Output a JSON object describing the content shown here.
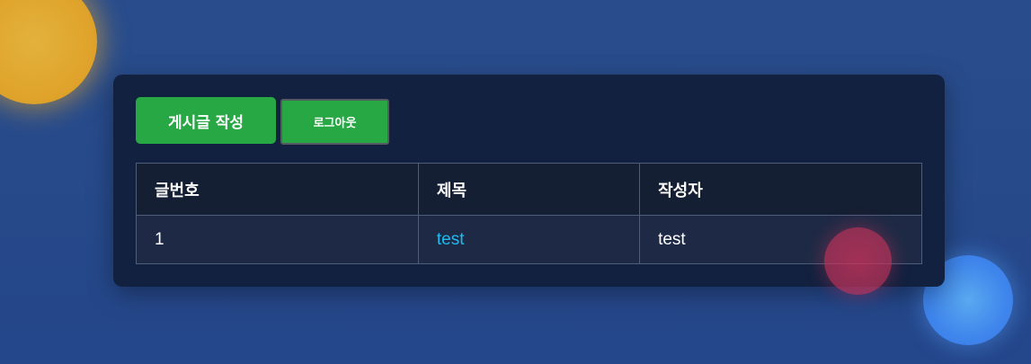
{
  "toolbar": {
    "write_label": "게시글 작성",
    "logout_label": "로그아웃"
  },
  "table": {
    "headers": {
      "number": "글번호",
      "title": "제목",
      "author": "작성자"
    },
    "rows": [
      {
        "number": "1",
        "title": "test",
        "author": "test"
      }
    ]
  },
  "colors": {
    "page_background": "#274b8b",
    "card_background": "#12213f",
    "button_green": "#28a745",
    "link_blue": "#1bbcf2",
    "orb_gold": "#e0a42c",
    "orb_blue": "#3f86ec",
    "orb_red": "#c8325a"
  }
}
